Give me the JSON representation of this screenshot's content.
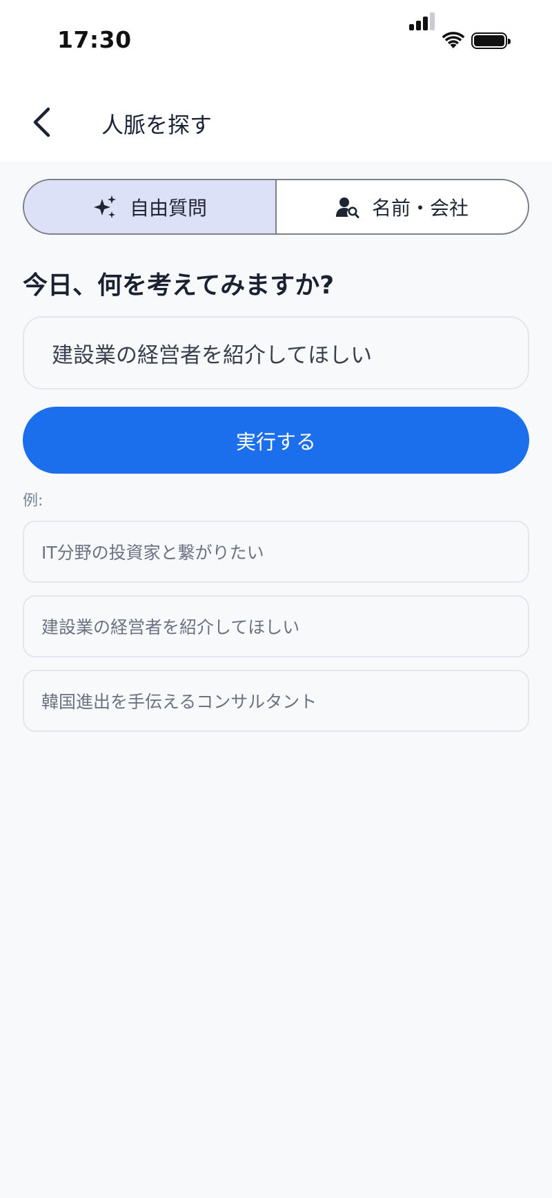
{
  "status_bar": {
    "time": "17:30",
    "icons": [
      "cellular-signal-icon",
      "wifi-icon",
      "battery-icon"
    ]
  },
  "nav": {
    "back_icon": "chevron-left-icon",
    "title": "人脈を探す"
  },
  "segments": [
    {
      "label": "自由質問",
      "icon": "sparkles-icon",
      "selected": true
    },
    {
      "label": "名前・会社",
      "icon": "person-search-icon",
      "selected": false
    }
  ],
  "question": "今日、何を考えてみますか?",
  "query": {
    "value": "建設業の経営者を紹介してほしい"
  },
  "run_button": "実行する",
  "examples": {
    "label": "例:",
    "items": [
      "IT分野の投資家と繋がりたい",
      "建設業の経営者を紹介してほしい",
      "韓国進出を手伝えるコンサルタント"
    ]
  },
  "colors": {
    "accent": "#1b6fed",
    "segment_selected_bg": "#dde1f7",
    "page_bg": "#f7f9fb"
  }
}
